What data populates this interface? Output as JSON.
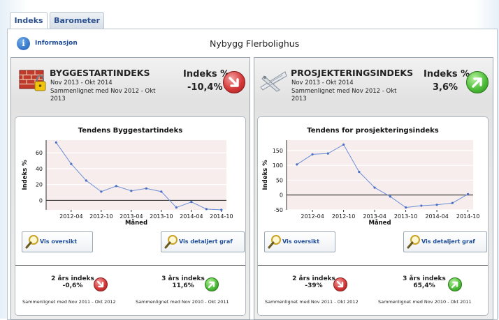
{
  "tabs": [
    {
      "label": "Indeks"
    },
    {
      "label": "Barometer"
    }
  ],
  "info": {
    "label": "Informasjon",
    "icon": "info-icon"
  },
  "page_title": "Nybygg Flerbolighus",
  "panels": [
    {
      "title": "BYGGESTARTINDEKS",
      "period": "Nov 2013 - Okt 2014",
      "compare_line1": "Sammenlignet med Nov 2012 - Okt",
      "compare_line2": "2013",
      "index_label": "Indeks %",
      "index_value": "-10,4%",
      "trend": "down",
      "icon": "brick-wall-lock-icon",
      "chart_title": "Tendens Byggestartindeks",
      "btn_overview": "Vis oversikt",
      "btn_detail": "Vis detaljert graf",
      "two_year_label": "2 års indeks",
      "two_year_value": "-0,6%",
      "two_year_trend": "down",
      "two_year_compare": "Sammenlignet med Nov 2011 - Okt 2012",
      "three_year_label": "3 års indeks",
      "three_year_value": "11,6%",
      "three_year_trend": "up",
      "three_year_compare": "Sammenlignet med Nov 2010 - Okt 2011"
    },
    {
      "title": "PROSJEKTERINGSINDEKS",
      "period": "Nov 2013 - Okt 2014",
      "compare_line1": "Sammenlignet med Nov 2012 - Okt",
      "compare_line2": "2013",
      "index_label": "Indeks %",
      "index_value": "3,6%",
      "trend": "up",
      "icon": "drafting-tools-icon",
      "chart_title": "Tendens for prosjekteringsindeks",
      "btn_overview": "Vis oversikt",
      "btn_detail": "Vis detaljert graf",
      "two_year_label": "2 års indeks",
      "two_year_value": "-39%",
      "two_year_trend": "down",
      "two_year_compare": "Sammenlignet med Nov 2011 - Okt 2012",
      "three_year_label": "3 års indeks",
      "three_year_value": "65,4%",
      "three_year_trend": "up",
      "three_year_compare": "Sammenlignet med Nov 2010 - Okt 2011"
    }
  ],
  "chart_data": [
    {
      "type": "line",
      "title": "Tendens Byggestartindeks",
      "xlabel": "Måned",
      "ylabel": "Indeks %",
      "x": [
        "2011-11",
        "2012-01",
        "2012-03",
        "2012-05",
        "2012-07",
        "2012-09",
        "2012-11",
        "2013-01",
        "2013-03",
        "2013-05",
        "2013-07",
        "2013-09",
        "2013-11",
        "2014-01",
        "2014-03",
        "2014-05",
        "2014-07",
        "2014-09",
        "2014-11"
      ],
      "values": [
        73,
        46,
        25,
        11,
        18,
        12,
        15,
        11,
        -9,
        -2,
        -11,
        -12
      ],
      "x_positions_month_index": [
        0,
        2,
        4,
        6,
        8,
        10,
        12,
        14,
        16,
        18,
        20,
        22
      ],
      "x_ticks": [
        "2012-04",
        "2012-10",
        "2013-04",
        "2013-10",
        "2014-04",
        "2014-10"
      ],
      "y_ticks": [
        0,
        20,
        40,
        60
      ],
      "ylim": [
        -12,
        76
      ],
      "grid": true,
      "color": "#6b8fd6"
    },
    {
      "type": "line",
      "title": "Tendens for prosjekteringsindeks",
      "xlabel": "Måned",
      "ylabel": "Indeks %",
      "values": [
        103,
        137,
        140,
        170,
        78,
        25,
        -5,
        -42,
        -36,
        -33,
        -27,
        3
      ],
      "x_positions_month_index": [
        0,
        2,
        4,
        6,
        8,
        10,
        12,
        14,
        16,
        18,
        20,
        22
      ],
      "x_ticks": [
        "2012-04",
        "2012-10",
        "2013-04",
        "2013-10",
        "2014-04",
        "2014-10"
      ],
      "y_ticks": [
        -50,
        0,
        50,
        100,
        150
      ],
      "ylim": [
        -50,
        185
      ],
      "grid": true,
      "color": "#6b8fd6"
    }
  ]
}
